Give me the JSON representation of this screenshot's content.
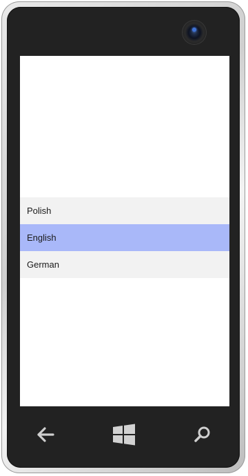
{
  "languages": {
    "items": [
      {
        "label": "Polish",
        "selected": false
      },
      {
        "label": "English",
        "selected": true
      },
      {
        "label": "German",
        "selected": false
      }
    ],
    "selected_color": "#a9b8f9",
    "item_color": "#f2f2f2"
  },
  "hardware_buttons": {
    "back_icon": "back-arrow-icon",
    "start_icon": "windows-logo-icon",
    "search_icon": "search-icon"
  }
}
